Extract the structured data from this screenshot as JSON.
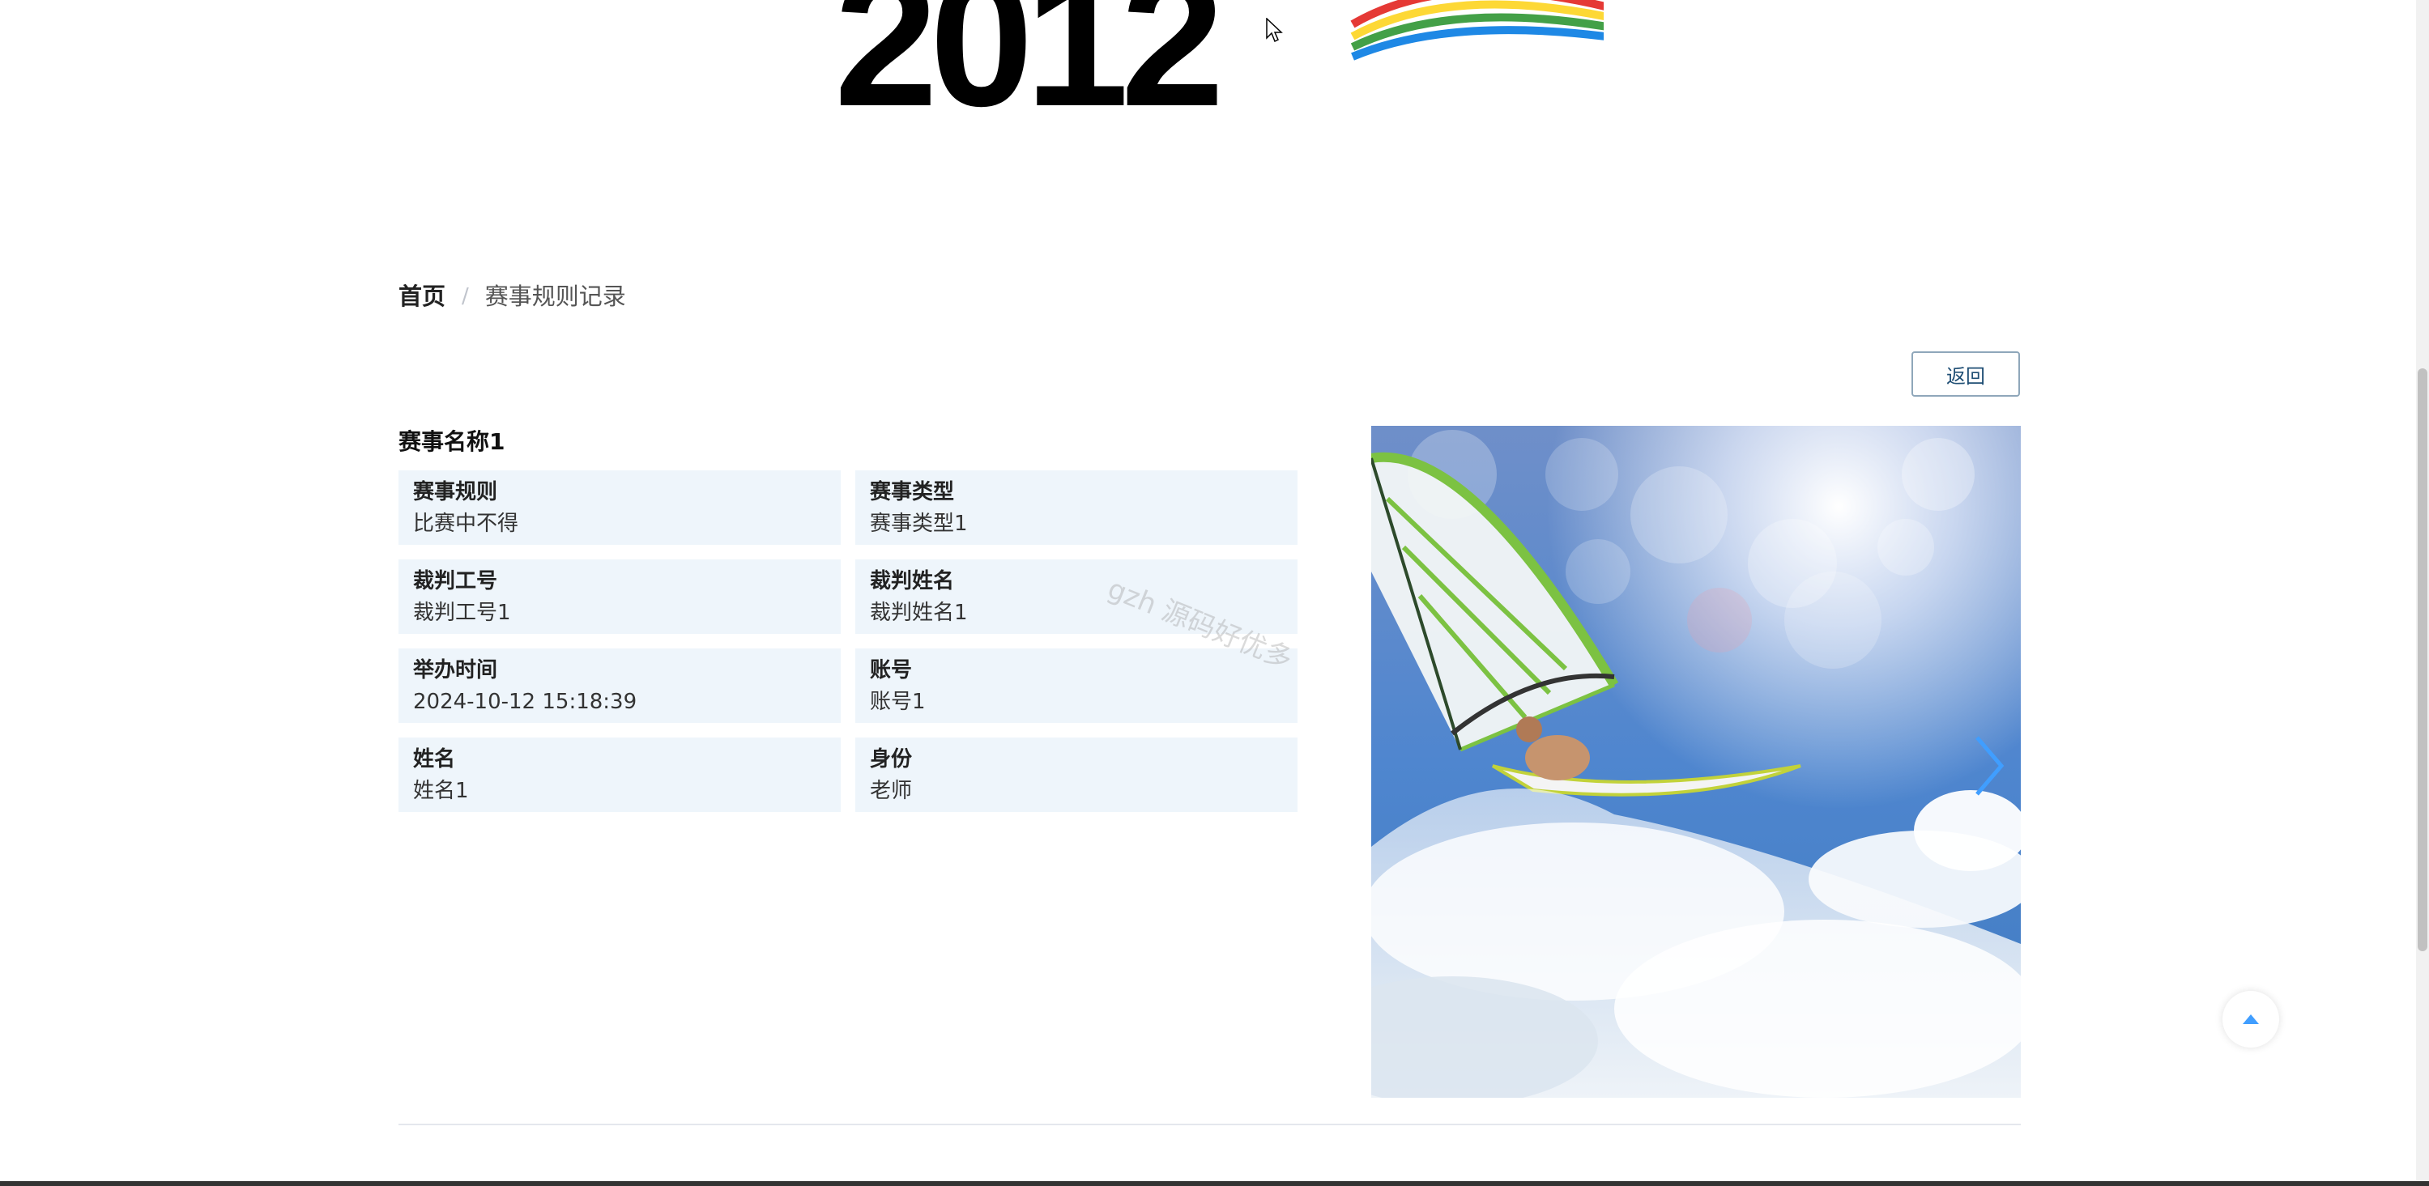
{
  "header": {
    "logo_text": "2012"
  },
  "breadcrumb": {
    "home": "首页",
    "separator": "/",
    "current": "赛事规则记录"
  },
  "actions": {
    "back_label": "返回"
  },
  "detail": {
    "title": "赛事名称1",
    "fields": [
      {
        "label": "赛事规则",
        "value": "比赛中不得"
      },
      {
        "label": "赛事类型",
        "value": "赛事类型1"
      },
      {
        "label": "裁判工号",
        "value": "裁判工号1"
      },
      {
        "label": "裁判姓名",
        "value": "裁判姓名1"
      },
      {
        "label": "举办时间",
        "value": "2024-10-12 15:18:39"
      },
      {
        "label": "账号",
        "value": "账号1"
      },
      {
        "label": "姓名",
        "value": "姓名1"
      },
      {
        "label": "身份",
        "value": "老师"
      }
    ]
  },
  "watermark": "gzh 源码好优多",
  "colors": {
    "accent": "#409eff",
    "cell_background": "#eef5fb",
    "button_border": "#8fa7ba",
    "button_text": "#1f4e74"
  },
  "icons": {
    "carousel_next": "chevron-right-icon",
    "back_to_top": "caret-up-icon"
  }
}
